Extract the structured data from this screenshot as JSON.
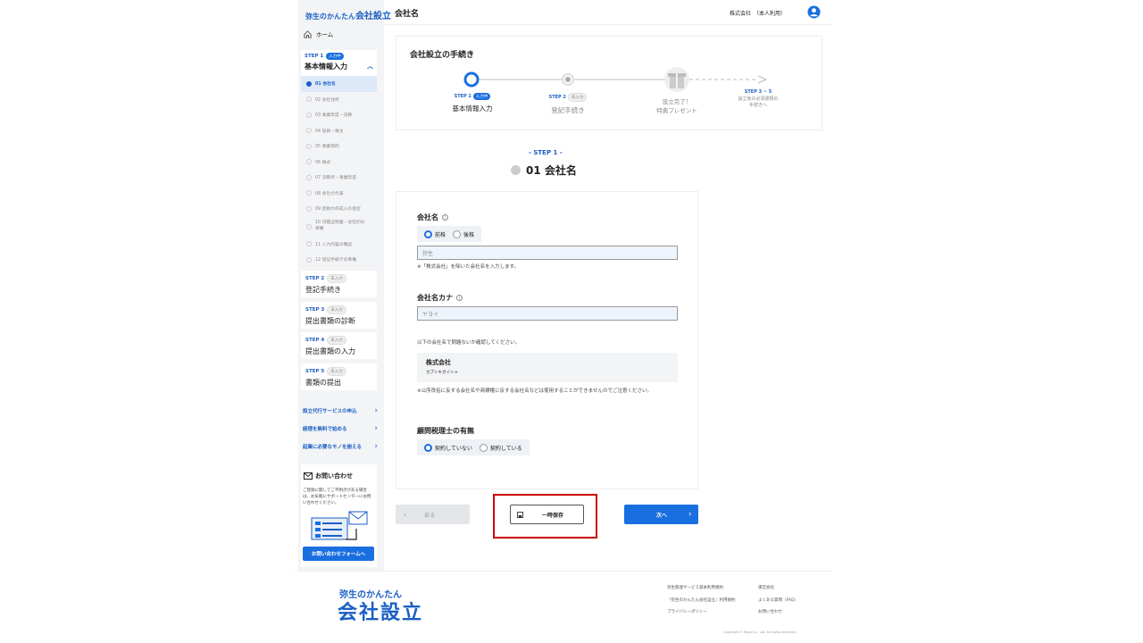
{
  "sidebar": {
    "logo_prefix": "弥生のかんたん",
    "logo_main": "会社設立",
    "home": "ホーム",
    "steps": [
      {
        "label": "STEP 1",
        "badge": "入力中",
        "title": "基本情報入力"
      },
      {
        "label": "STEP 2",
        "badge": "未入力",
        "title": "登記手続き"
      },
      {
        "label": "STEP 3",
        "badge": "未入力",
        "title": "提出書類の診断"
      },
      {
        "label": "STEP 4",
        "badge": "未入力",
        "title": "提出書類の入力"
      },
      {
        "label": "STEP 5",
        "badge": "未入力",
        "title": "書類の提出"
      }
    ],
    "sub_items": [
      "01 会社名",
      "02 会社住所",
      "03 事業年度・決算",
      "04 役員・株主",
      "05 事業目的",
      "06 株式",
      "07 決算月・事業年度",
      "08 会社の代表",
      "09 定款の作成人の指定",
      "10 印鑑証明書・会社印の準備",
      "11 入力内容の確認",
      "12 登記手続きの準備"
    ],
    "links": [
      "設立代行サービスの申込",
      "経理を無料で始める",
      "起業に必要なモノを揃える"
    ],
    "contact_title": "お問い合わせ",
    "contact_text": "ご登録に関してご不明点がある場合は、お気軽にサポートセンターにお問い合わせください。",
    "contact_button": "お問い合わせフォームへ"
  },
  "header": {
    "title": "会社名",
    "company": "株式会社　（本人利用）"
  },
  "progress": {
    "title": "会社設立の手続き",
    "nodes": [
      {
        "label": "STEP 1",
        "badge": "入力中",
        "name": "基本情報入力"
      },
      {
        "label": "STEP 2",
        "badge": "未入力",
        "name": "登記手続き"
      },
      {
        "label": "",
        "badge": "",
        "name": "設立完了！\n特典プレゼント"
      },
      {
        "label": "STEP 3 ~ 5",
        "badge": "",
        "name": "設立後の必須書類の\n手続きへ"
      }
    ]
  },
  "main": {
    "step_mini": "- STEP 1 -",
    "title": "01  会社名"
  },
  "form": {
    "name_label": "会社名",
    "name_radio_1": "前株",
    "name_radio_2": "後株",
    "name_placeholder": "弥生",
    "name_note": "※「株式会社」を除いた会社名を入力します。",
    "kana_label": "会社名カナ",
    "kana_placeholder": "ヤヨイ",
    "check_text": "以下の会社名で問題ないか確認してください。",
    "preview_name": "株式会社",
    "preview_kana": "カブシキガイシャ",
    "warning": "※公序良俗に反する会社名や商標権に反する会社名などは使用することができませんのでご注意ください。",
    "tax_label": "顧問税理士の有無",
    "tax_radio_1": "契約していない",
    "tax_radio_2": "契約している"
  },
  "buttons": {
    "back": "戻る",
    "save": "一時保存",
    "next": "次へ"
  },
  "footer": {
    "logo_prefix": "弥生のかんたん",
    "logo_main": "会社設立",
    "links_col1": [
      "弥生関連サービス基本利用規約",
      "『弥生のかんたん会社設立』利用規約",
      "プライバシーポリシー"
    ],
    "links_col2": [
      "運営会社",
      "よくある質問（FAQ）",
      "お問い合わせ"
    ],
    "copyright": "Copyright © Yayoi Co., Ltd. All rights reserved."
  },
  "colors": {
    "accent": "#1a6fe0",
    "highlight": "#cc0000"
  }
}
